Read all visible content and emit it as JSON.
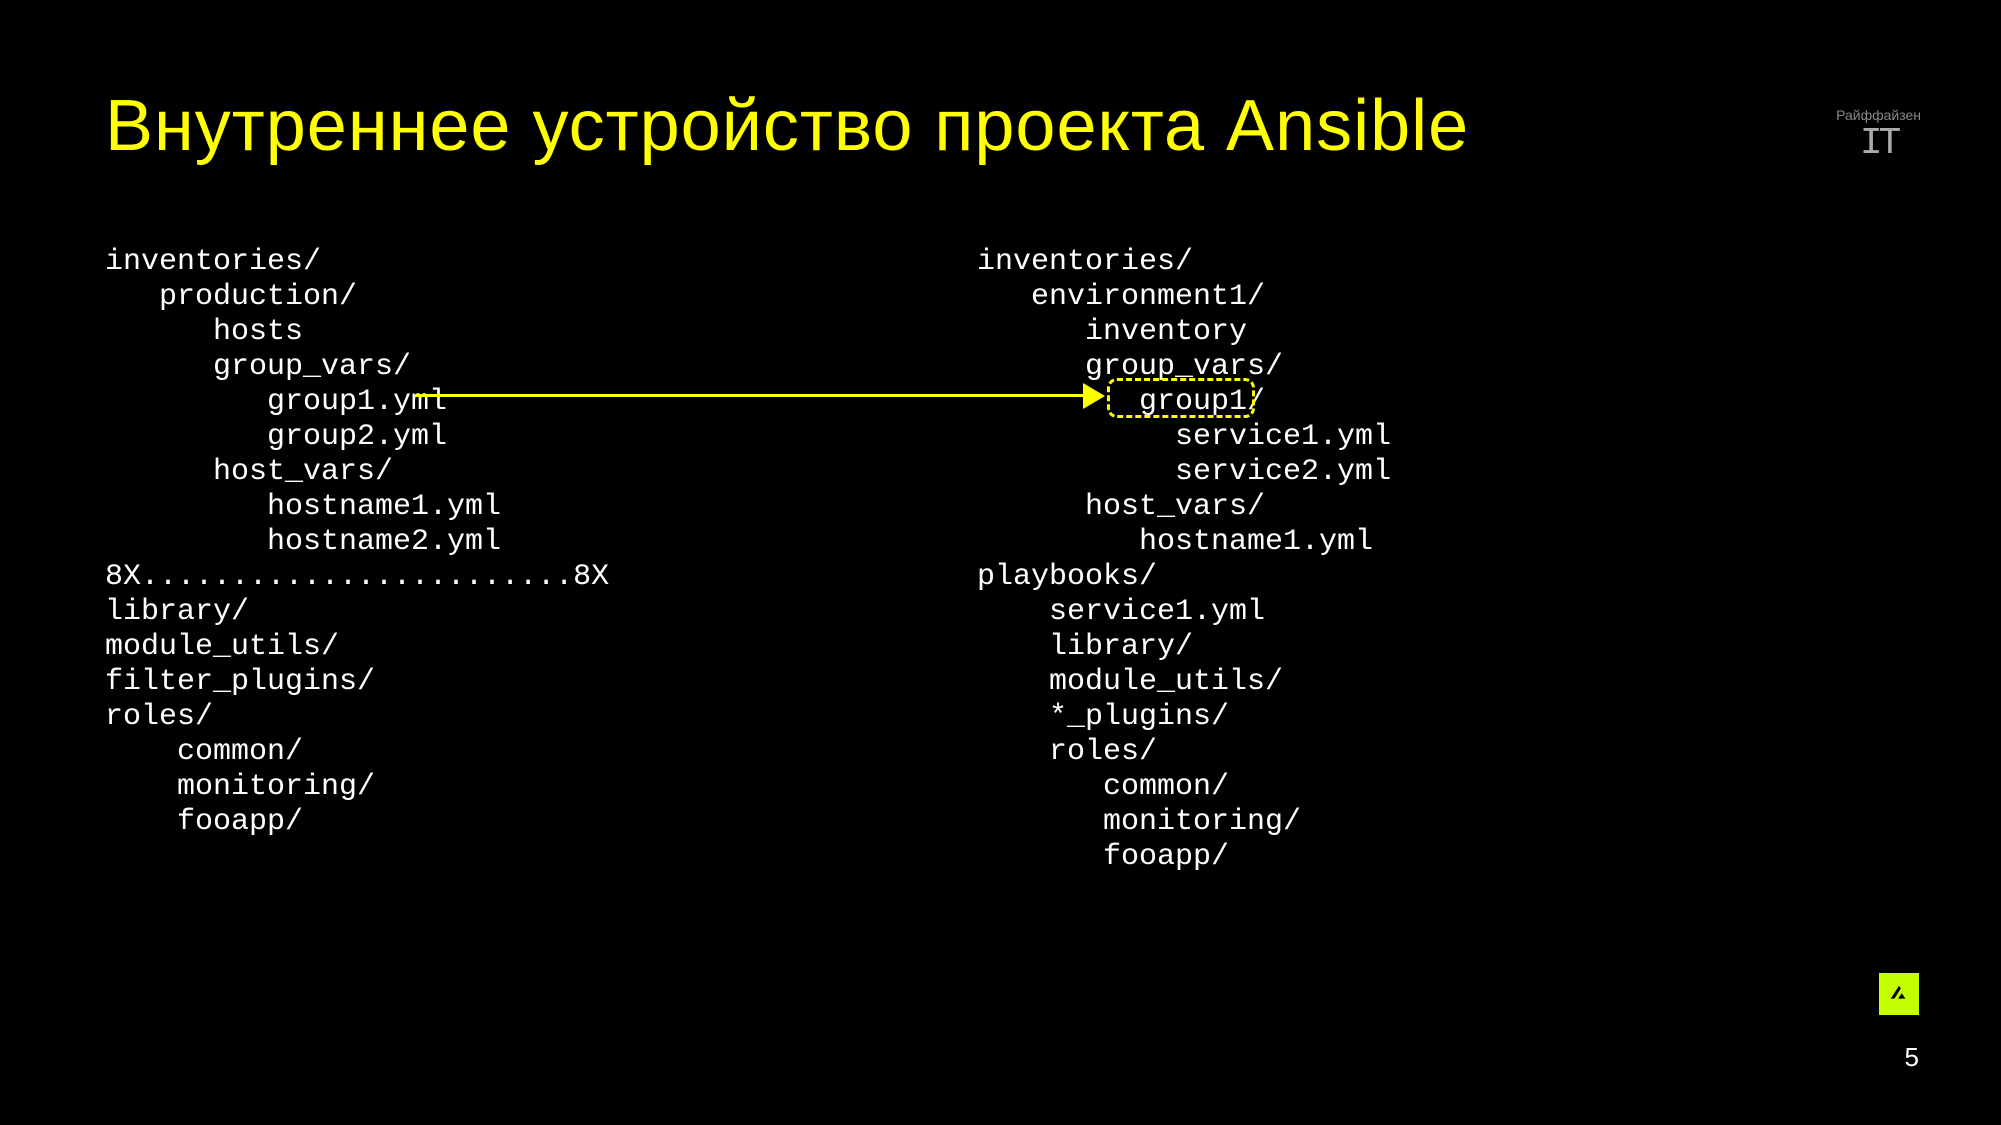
{
  "title": "Внутреннее устройство проекта Ansible",
  "logo_top": {
    "brand": "Райффайзен",
    "it": "IT"
  },
  "page_number": "5",
  "highlighted_target": "group1/",
  "tree_left": "inventories/\n   production/\n      hosts\n      group_vars/\n         group1.yml\n         group2.yml\n      host_vars/\n         hostname1.yml\n         hostname2.yml\n8X........................8X\nlibrary/\nmodule_utils/\nfilter_plugins/\nroles/\n    common/\n    monitoring/\n    fooapp/",
  "tree_right": "inventories/\n   environment1/\n      inventory\n      group_vars/\n         group1/\n           service1.yml\n           service2.yml\n      host_vars/\n         hostname1.yml\nplaybooks/\n    service1.yml\n    library/\n    module_utils/\n    *_plugins/\n    roles/\n       common/\n       monitoring/\n       fooapp/"
}
